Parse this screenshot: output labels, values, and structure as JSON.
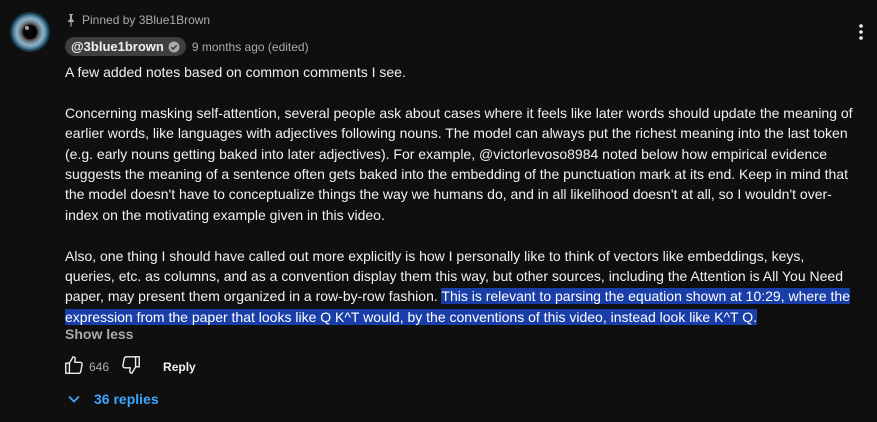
{
  "comment": {
    "pinned_label": "Pinned by 3Blue1Brown",
    "author": "@3blue1brown",
    "timestamp": "9 months ago (edited)",
    "paragraphs": [
      "A few added notes based on common comments I see.",
      "Concerning masking self-attention, several people ask about cases where it feels like later words should update the meaning of earlier words, like languages with adjectives following nouns. The model can always put the richest meaning into the last token (e.g. early nouns getting baked into later adjectives). For example, @victorlevoso8984 noted below how empirical evidence suggests the meaning of a sentence often gets baked into the embedding of the punctuation mark at its end. Keep in mind that the model doesn't have to conceptualize things the way we humans do, and in all likelihood doesn't at all, so I wouldn't over-index on the motivating example given in this video."
    ],
    "paragraph3_plain": "Also, one thing I should have called out more explicitly is how I personally like to think of vectors like embeddings, keys, queries, etc. as columns, and as a convention display them this way, but other sources, including the Attention is All You Need paper, may present them organized in a row-by-row fashion. ",
    "paragraph3_selected": "This is relevant to parsing the equation shown at 10:29, where the expression from the paper that looks like Q K^T would, by the conventions of this video, instead look like K^T Q.",
    "show_less_label": "Show less",
    "like_count": "646",
    "reply_label": "Reply",
    "replies_label": "36 replies"
  },
  "icons": {
    "pin": "pin-icon",
    "verified": "verified-check-icon",
    "menu": "more-vertical-icon",
    "like": "thumbs-up-icon",
    "dislike": "thumbs-down-icon",
    "replies": "chevron-down-icon"
  },
  "colors": {
    "background": "#0f0f0f",
    "text": "#f1f1f1",
    "secondary_text": "#aaaaaa",
    "author_chip": "#3f3f3f",
    "selection": "#1a3ea8",
    "link_blue": "#3ea6ff"
  }
}
